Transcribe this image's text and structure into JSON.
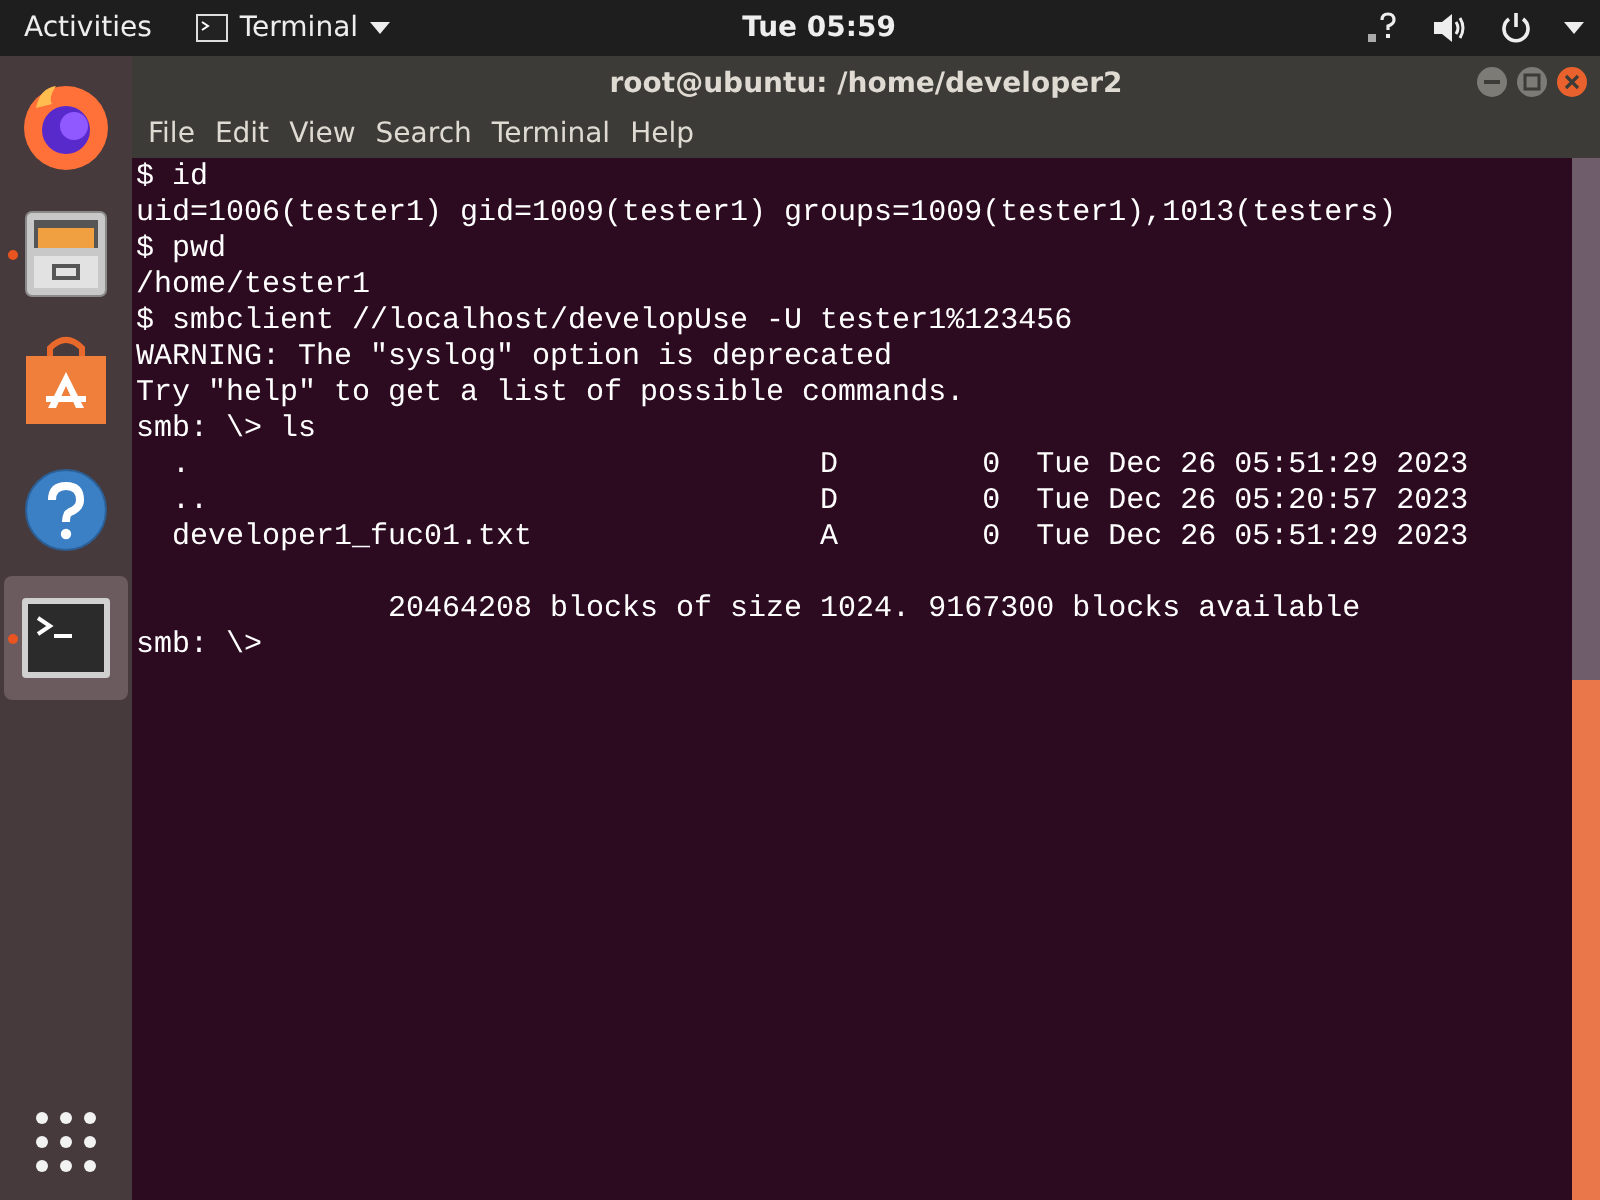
{
  "top_bar": {
    "activities": "Activities",
    "app_menu": "Terminal",
    "clock": "Tue 05:59"
  },
  "dock": {
    "items": [
      {
        "kind": "browser",
        "running": false,
        "selected": false
      },
      {
        "kind": "files",
        "running": true,
        "selected": false
      },
      {
        "kind": "software",
        "running": false,
        "selected": false
      },
      {
        "kind": "help",
        "running": false,
        "selected": false
      },
      {
        "kind": "terminal",
        "running": true,
        "selected": true
      }
    ]
  },
  "window": {
    "title": "root@ubuntu: /home/developer2"
  },
  "menu": [
    "File",
    "Edit",
    "View",
    "Search",
    "Terminal",
    "Help"
  ],
  "terminal": {
    "blocks": [
      {
        "lines": [
          "$ id",
          "uid=1006(tester1) gid=1009(tester1) groups=1009(tester1),1013(testers)",
          "$ pwd",
          "/home/tester1",
          "$ smbclient //localhost/developUse -U tester1%123456",
          "WARNING: The \"syslog\" option is deprecated",
          "Try \"help\" to get a list of possible commands.",
          "smb: \\> ls",
          "  .                                   D        0  Tue Dec 26 05:51:29 2023",
          "  ..                                  D        0  Tue Dec 26 05:20:57 2023",
          "  developer1_fuc01.txt                A        0  Tue Dec 26 05:51:29 2023"
        ]
      },
      {
        "lines": [
          "              20464208 blocks of size 1024. 9167300 blocks available",
          "smb: \\>"
        ]
      }
    ]
  }
}
